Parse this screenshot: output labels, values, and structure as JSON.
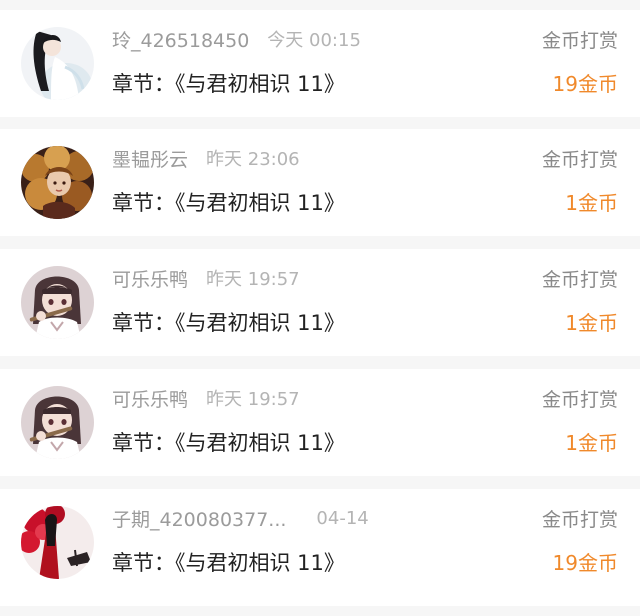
{
  "colors": {
    "amount": "#f0892b",
    "name": "#9b9b9b",
    "time": "#b4b4b4",
    "title": "#222222",
    "type": "#8a8a8a"
  },
  "records": [
    {
      "username": "玲_426518450",
      "time": "今天 00:15",
      "chapter": "章节：《与君初相识 11》",
      "type": "金币打赏",
      "amount": "19金币",
      "avatar": "avatar-girl-white-dress"
    },
    {
      "username": "墨韫彤云",
      "time": "昨天 23:06",
      "chapter": "章节：《与君初相识 11》",
      "type": "金币打赏",
      "amount": "1金币",
      "avatar": "avatar-curly-hair-girl"
    },
    {
      "username": "可乐乐鸭",
      "time": "昨天 19:57",
      "chapter": "章节：《与君初相识 11》",
      "type": "金币打赏",
      "amount": "1金币",
      "avatar": "avatar-anime-girl-flute"
    },
    {
      "username": "可乐乐鸭",
      "time": "昨天 19:57",
      "chapter": "章节：《与君初相识 11》",
      "type": "金币打赏",
      "amount": "1金币",
      "avatar": "avatar-anime-girl-flute"
    },
    {
      "username": "子期_420080377...",
      "time": "04-14",
      "chapter": "章节：《与君初相识 11》",
      "type": "金币打赏",
      "amount": "19金币",
      "avatar": "avatar-red-robe-figure"
    }
  ]
}
